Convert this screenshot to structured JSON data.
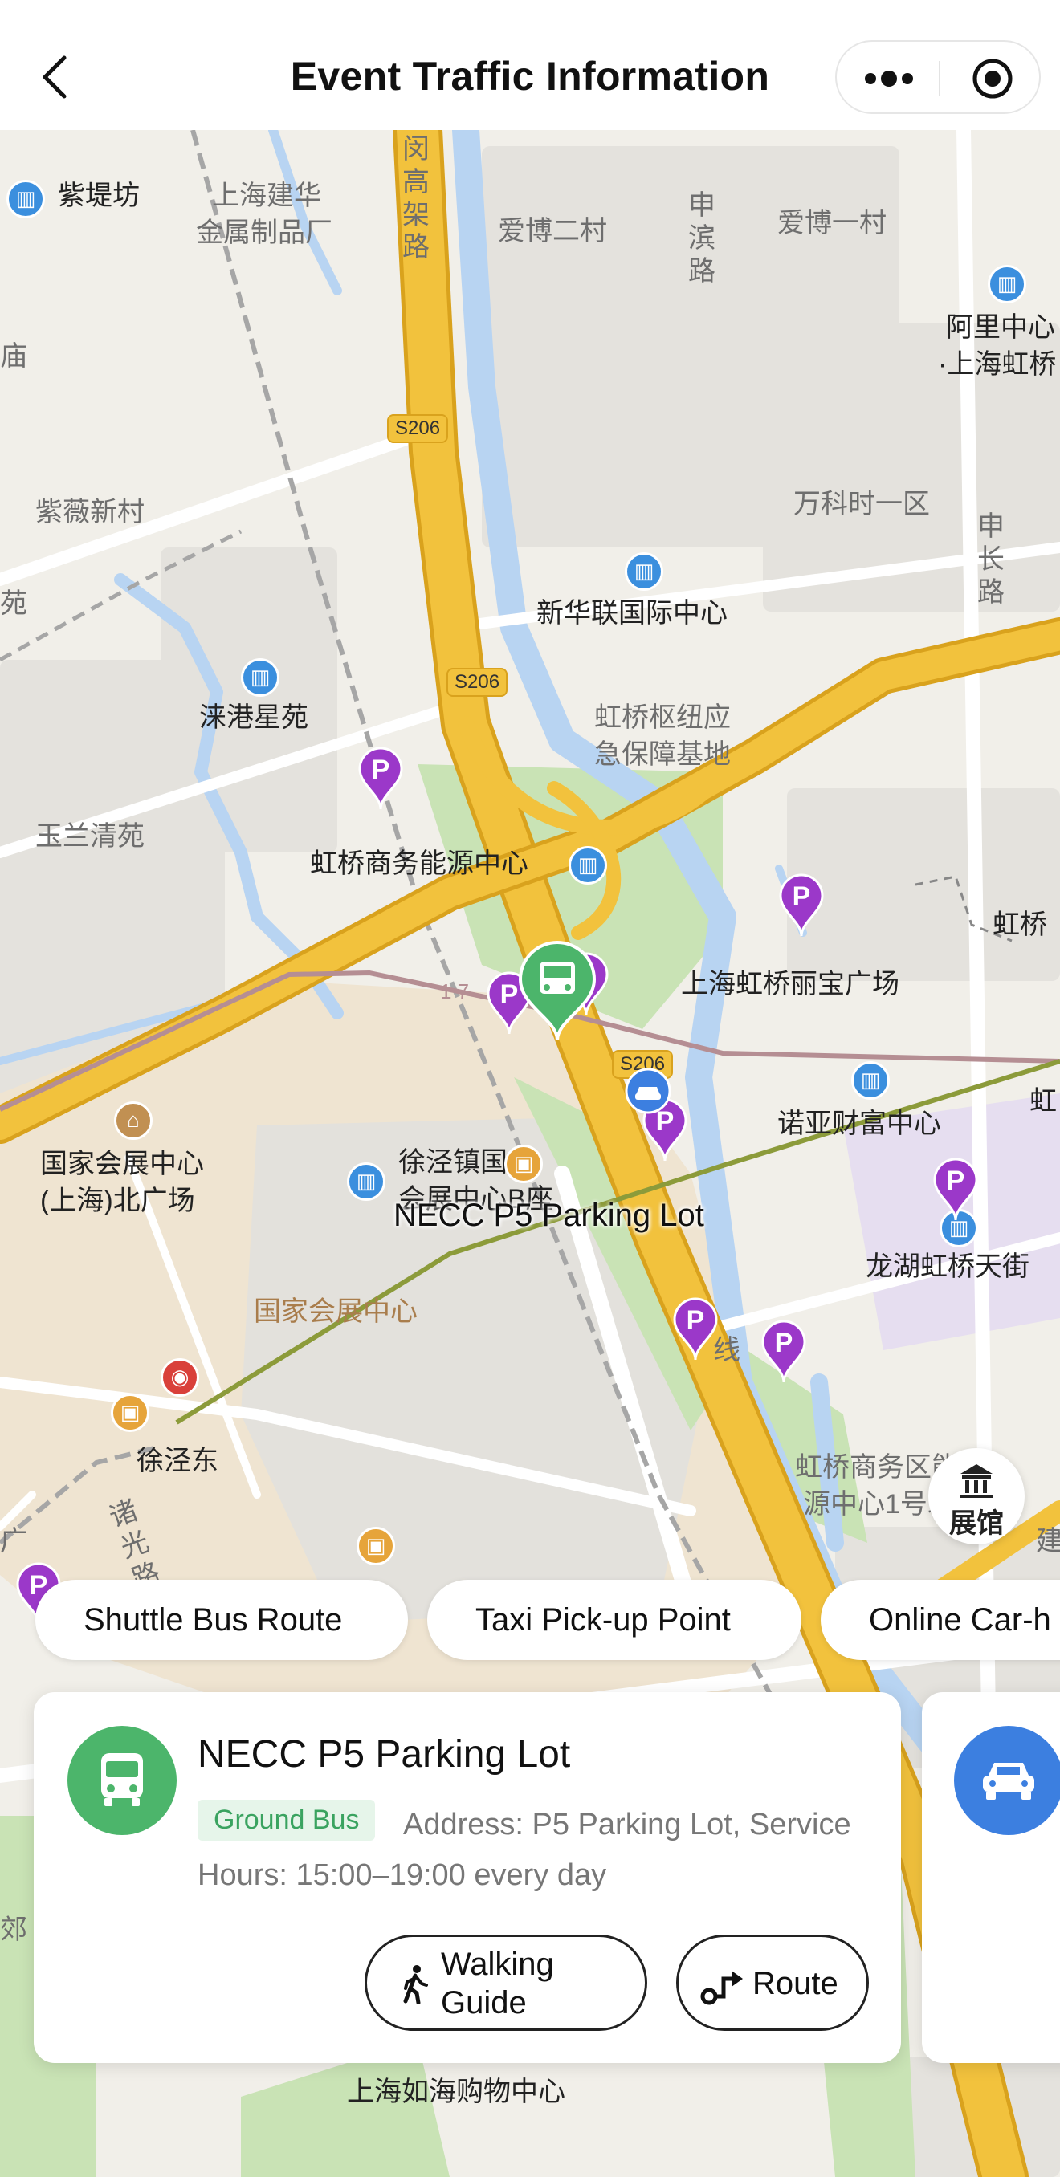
{
  "header": {
    "title": "Event Traffic Information"
  },
  "map": {
    "labels": {
      "zidifang": "紫堤坊",
      "jianhua1": "上海建华",
      "jianhua2": "金属制品厂",
      "expressway": "闵高架路",
      "aibo2": "爱博二村",
      "shenbin": "申滨路",
      "aibo1": "爱博一村",
      "alibaba1": "阿里中心",
      "alibaba2": "·上海虹桥",
      "miao": "庙",
      "ziwei": "紫薇新村",
      "wanke": "万科时一区",
      "shenchang": "申长路",
      "yuan": "苑",
      "xinhualian": "新华联国际中心",
      "laigang": "涞港星苑",
      "hub1": "虹桥枢纽应",
      "hub2": "急保障基地",
      "yulan": "玉兰清苑",
      "energy": "虹桥商务能源中心",
      "hongqiao_right": "虹桥",
      "libao": "上海虹桥丽宝广场",
      "nuoya": "诺亚财富中心",
      "hong_edge": "虹",
      "necc_north1": "国家会展中心",
      "necc_north2": "(上海)北广场",
      "xujing1": "徐泾镇国家",
      "xujing2": "会展中心B座",
      "longhu": "龙湖虹桥天街",
      "necc": "国家会展中心",
      "xujingdong": "徐泾东",
      "zhuguang": "诸光路",
      "energy2_1": "虹桥商务区能",
      "energy2_2": "源中心1号站",
      "rugong": "上海如海购物中心",
      "jiao": "郊",
      "guang": "广",
      "line": "线",
      "s206": "S206",
      "line17": "1 7",
      "edge_right": "建"
    },
    "focus_label": "NECC P5 Parking Lot",
    "pavilion_label": "展馆",
    "route_colors": {
      "expressway": "#f0c043",
      "water": "#b8d4f2",
      "green": "#c9e3b5",
      "metro_line": "#8c9b3a",
      "rail": "#b58e93"
    }
  },
  "chips": [
    {
      "label": "Shuttle Bus Route"
    },
    {
      "label": "Taxi Pick-up Point"
    },
    {
      "label": "Online Car-h"
    }
  ],
  "card": {
    "name": "NECC P5 Parking Lot",
    "badge": "Ground Bus",
    "address": "Address: P5 Parking Lot, Service Hours: 15:00–19:00 every day",
    "walking_label_line1": "Walking",
    "walking_label_line2": "Guide",
    "route_label": "Route",
    "icon": "bus-icon"
  },
  "card2": {
    "icon": "car-icon"
  }
}
